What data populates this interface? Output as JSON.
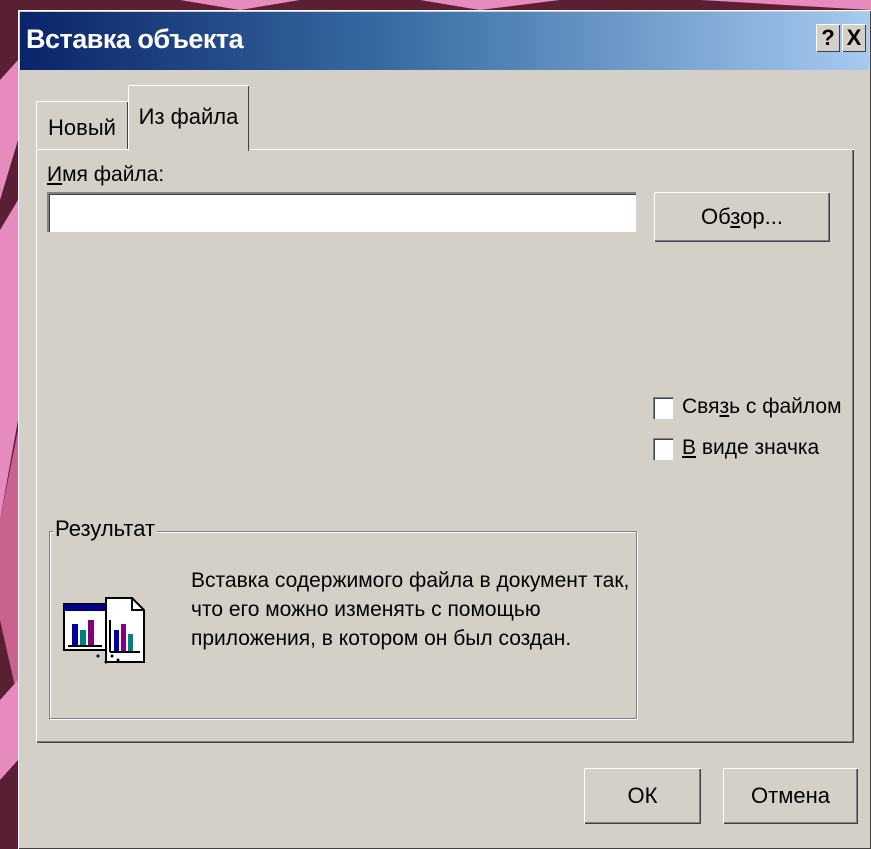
{
  "dialog": {
    "title": "Вставка объекта",
    "help_label": "?",
    "close_label": "X"
  },
  "tabs": [
    {
      "label": "Новый",
      "active": false
    },
    {
      "label": "Из файла",
      "active": true
    }
  ],
  "file_name": {
    "label_hotkey": "И",
    "label_rest": "мя файла:",
    "value": ""
  },
  "browse_button": {
    "pre": "Об",
    "hotkey": "з",
    "post": "ор..."
  },
  "options": {
    "link": {
      "pre": "Свя",
      "hotkey": "з",
      "post": "ь с файлом",
      "checked": false
    },
    "as_icon": {
      "pre": "",
      "hotkey": "В",
      "post": " виде значка",
      "checked": false
    }
  },
  "result": {
    "title": "Результат",
    "lines": [
      "Вставка содержимого файла в документ так,",
      "что его можно изменять с помощью",
      "приложения, в котором он был создан."
    ],
    "icon": "insert-file-document-icon"
  },
  "buttons": {
    "ok_label": "ОК",
    "cancel_label": "Отмена"
  },
  "colors": {
    "desktop": "#5a1f33",
    "pink": "#e78bbf",
    "title_start": "#0a246a",
    "title_end": "#a6caf0",
    "dialog": "#d4d0c8"
  }
}
